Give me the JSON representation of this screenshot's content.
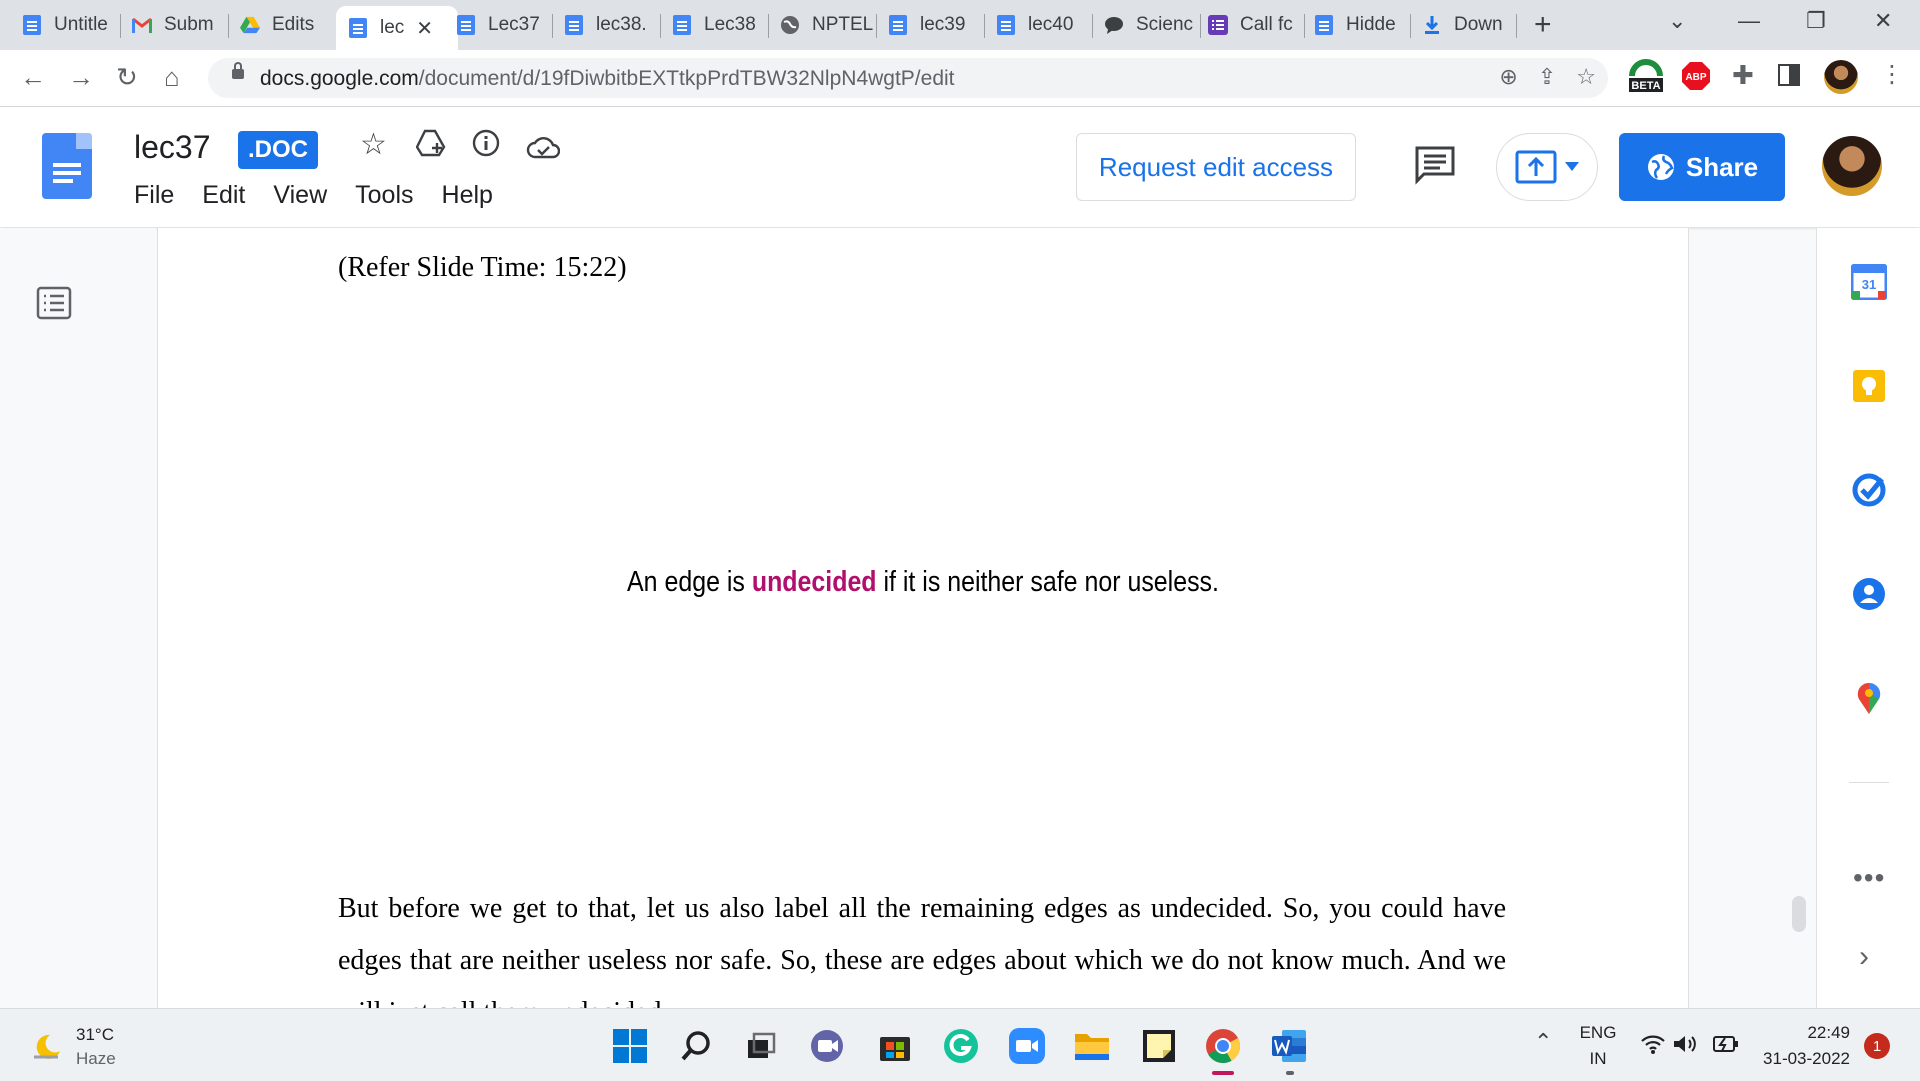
{
  "browser": {
    "tabs": [
      {
        "label": "Untitle",
        "icon": "docs"
      },
      {
        "label": "Subm",
        "icon": "gmail"
      },
      {
        "label": "Edits",
        "icon": "drive"
      },
      {
        "label": "lec",
        "icon": "docs",
        "active": true
      },
      {
        "label": "Lec37",
        "icon": "docs"
      },
      {
        "label": "lec38.",
        "icon": "docs"
      },
      {
        "label": "Lec38",
        "icon": "docs"
      },
      {
        "label": "NPTEL",
        "icon": "globe"
      },
      {
        "label": "lec39",
        "icon": "docs"
      },
      {
        "label": "lec40",
        "icon": "docs"
      },
      {
        "label": "Scienc",
        "icon": "chat"
      },
      {
        "label": "Call fc",
        "icon": "forms"
      },
      {
        "label": "Hidde",
        "icon": "docs"
      },
      {
        "label": "Down",
        "icon": "download"
      }
    ],
    "new_tab": "+",
    "url_host": "docs.google.com",
    "url_path": "/document/d/19fDiwbitbEXTtkpPrdTBW32NlpN4wgtP/edit",
    "extension_badge": "BETA",
    "abp": "ABP"
  },
  "docs": {
    "title": "lec37",
    "badge": ".DOC",
    "menu": [
      "File",
      "Edit",
      "View",
      "Tools",
      "Help"
    ],
    "request_edit": "Request edit access",
    "share": "Share"
  },
  "content": {
    "refer": "(Refer Slide Time: 15:22)",
    "slide_before": "An edge is ",
    "slide_highlight": "undecided",
    "slide_after": " if it is neither safe nor useless.",
    "paragraph": "But before we get to that, let us also label all the remaining edges as undecided. So, you could have edges that are neither useless nor safe. So, these are edges about which we do not know much. And we will just call them undecided."
  },
  "side_panel": {
    "calendar_day": "31",
    "more": "•••"
  },
  "taskbar": {
    "temperature": "31°C",
    "weather": "Haze",
    "lang_top": "ENG",
    "lang_bottom": "IN",
    "time": "22:49",
    "date": "31-03-2022",
    "notifications": "1"
  },
  "colors": {
    "accent": "#1a73e8",
    "highlight": "#b00f6b"
  }
}
